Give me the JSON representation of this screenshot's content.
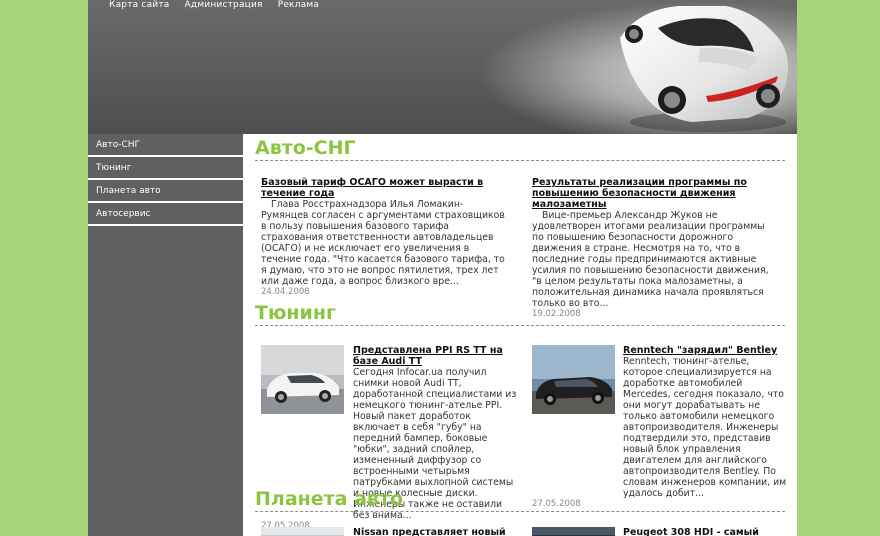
{
  "topnav": [
    "Карта сайта",
    "Администрация",
    "Реклама"
  ],
  "sidebar": [
    "Авто-СНГ",
    "Тюнинг",
    "Планета авто",
    "Автосервис"
  ],
  "colors": {
    "accent": "#8bc53f",
    "background": "#a6d37c",
    "sidebar": "#606060"
  },
  "sections": {
    "auto_sng": {
      "title": "Авто-СНГ",
      "articles": [
        {
          "title": "Базовый тариф ОСАГО может вырасти в течение года",
          "body": "Глава Росстрахнадзора Илья Ломакин-Румянцев согласен с аргументами страховщиков в пользу повышения базового тарифа страхования ответственности автовладельцев (ОСАГО) и не исключает его увеличения в течение года. \"Что касается базового тарифа, то я думаю, что это не вопрос пятилетия, трех лет или даже года, а вопрос близкого вре...",
          "date": "24.04.2008"
        },
        {
          "title": "Результаты реализации программы по повышению безопасности движения малозаметны",
          "body": "Вице-премьер Александр Жуков не удовлетворен итогами реализации программы по повышению безопасности дорожного движения в стране. Несмотря на то, что в последние годы предпринимаются активные усилия по повышению безопасности движения, \"в целом результаты пока малозаметны, а положительная динамика начала проявляться только во вто...",
          "date": "19.02.2008"
        }
      ]
    },
    "tuning": {
      "title": "Тюнинг",
      "articles": [
        {
          "title": "Представлена PPI RS TT на базе Audi TT",
          "body": "Сегодня Infocar.ua получил снимки новой Audi TT, доработанной специалистами из немецкого тюнинг-ателье PPI. Новый пакет доработок включает в себя \"губу\" на передний бампер, боковые \"юбки\", задний спойлер, измененный диффузор со встроенными четырьмя патрубками выхлопной системы и новые колесные диски. Инженеры также не оставили без внима...",
          "date": "27.05.2008",
          "image": "white-audi-tt-photo"
        },
        {
          "title": "Renntech \"зарядил\" Bentley",
          "body": "Renntech, тюнинг-ателье, которое специализируется на доработке автомобилей Mercedes, сегодня показало, что они могут дорабатывать не только автомобили немецкого автопроизводителя. Инженеры подтвердили это, представив новый блок управления двигателем для английского автопроизводителя Bentley. По словам инженеров компании, им удалось добит...",
          "date": "27.05.2008",
          "image": "black-bentley-photo"
        }
      ]
    },
    "planet": {
      "title": "Планета авто",
      "articles": [
        {
          "title": "Nissan представляет новый",
          "image": "nissan-photo"
        },
        {
          "title": "Peugeot 308 HDI - самый",
          "image": "peugeot-photo"
        }
      ]
    }
  }
}
